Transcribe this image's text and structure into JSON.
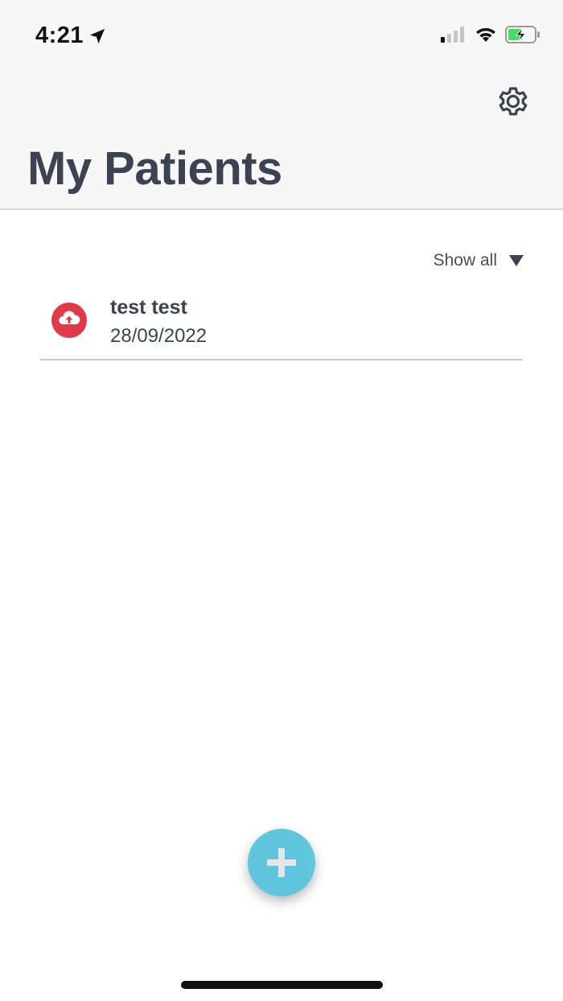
{
  "status_bar": {
    "time": "4:21",
    "location_icon": "location-arrow-icon",
    "signal_icon": "cellular-signal-icon",
    "wifi_icon": "wifi-icon",
    "battery_icon": "battery-charging-icon",
    "battery_color": "#4cd964"
  },
  "header": {
    "title": "My Patients",
    "settings_icon": "gear-icon"
  },
  "filter": {
    "label": "Show all",
    "icon": "triangle-down-icon"
  },
  "patients": [
    {
      "name": "test test",
      "date": "28/09/2022",
      "status_icon": "cloud-upload-icon",
      "status_color": "#e0394a"
    }
  ],
  "fab": {
    "icon": "plus-icon",
    "color": "#5fc6de"
  },
  "colors": {
    "title": "#3b4252",
    "header_bg": "#f7f7f7"
  }
}
